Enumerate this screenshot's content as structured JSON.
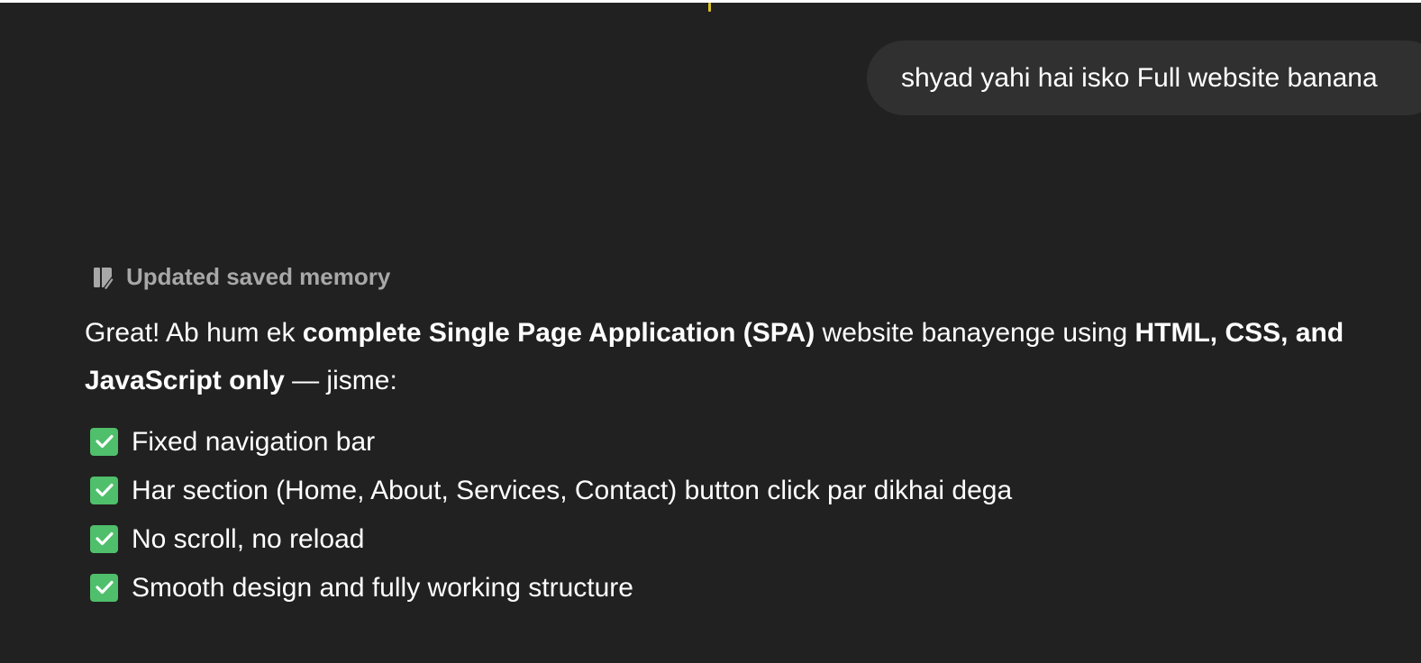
{
  "conversation": {
    "user_message": "shyad yahi hai isko Full website banana",
    "memory_notice": {
      "icon": "memory-edit-icon",
      "label": "Updated saved memory"
    },
    "assistant": {
      "intro_1": "Great! Ab hum ek ",
      "intro_bold_1": "complete Single Page Application (SPA)",
      "intro_2": " website banayenge using ",
      "intro_bold_2": "HTML, CSS, and JavaScript only",
      "intro_3": " — jisme:",
      "checklist": [
        "Fixed navigation bar",
        "Har section (Home, About, Services, Contact) button click par dikhai dega",
        "No scroll, no reload",
        "Smooth design and fully working structure"
      ],
      "check_icon": "check-mark-emoji-icon",
      "check_color": "#4fbf6b"
    }
  }
}
